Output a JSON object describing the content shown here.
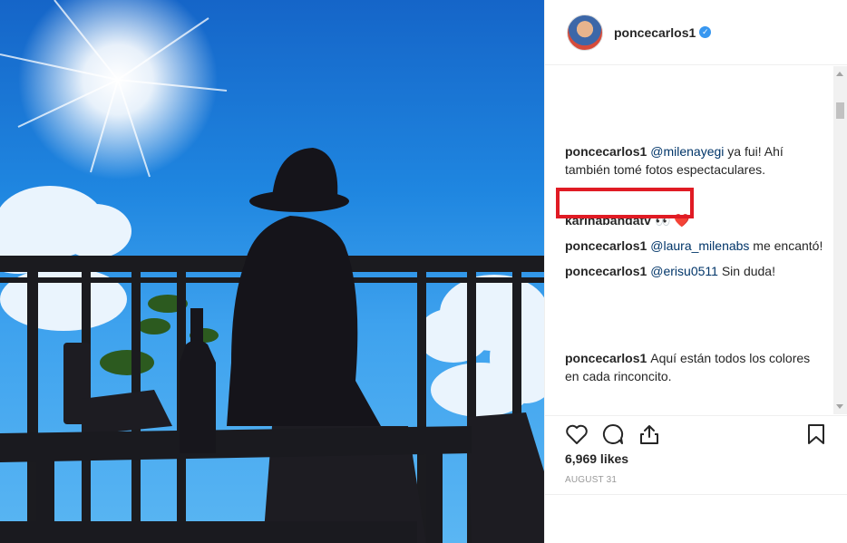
{
  "post": {
    "author": "poncecarlos1",
    "likes": "6,969 likes",
    "date": "AUGUST 31"
  },
  "comments": [
    {
      "user": "poncecarlos1",
      "mention": "@milenayegi",
      "text": " ya fui! Ahí también tomé fotos espectaculares."
    },
    {
      "user": "karinabandatv",
      "text": "👀 ❤️"
    },
    {
      "user": "poncecarlos1",
      "mention": "@laura_milenabs",
      "text": " me encantó!"
    },
    {
      "user": "poncecarlos1",
      "mention": "@erisu0511",
      "text": " Sin duda!"
    },
    {
      "user": "poncecarlos1",
      "text": "Aquí están todos los colores en cada rinconcito."
    }
  ],
  "icons": {
    "verified": "verified-badge-icon",
    "like": "heart-icon",
    "comment": "comment-bubble-icon",
    "share": "share-upload-icon",
    "save": "bookmark-icon"
  },
  "colors": {
    "accent": "#3897f0",
    "highlight": "#e01b24",
    "mention": "#003569"
  }
}
